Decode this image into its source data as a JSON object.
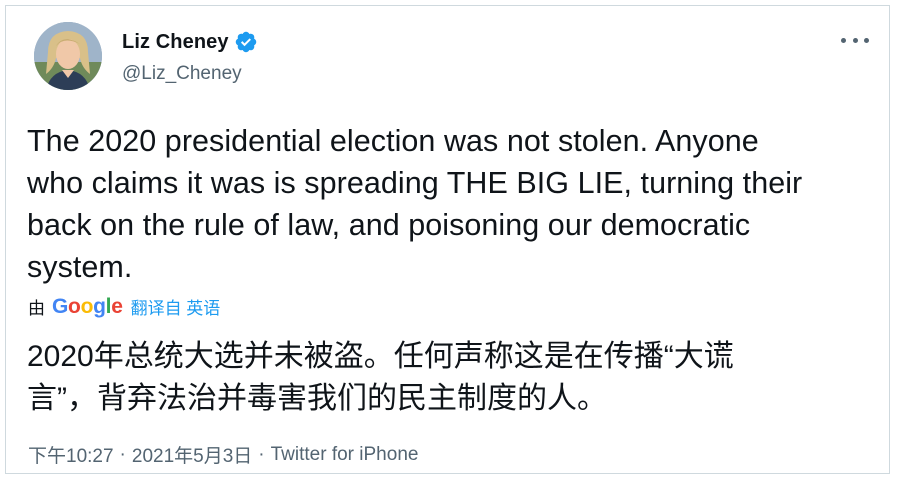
{
  "author": {
    "display_name": "Liz Cheney",
    "handle": "@Liz_Cheney",
    "verified_icon": "verified-badge-icon"
  },
  "more_icon": "more-horizontal-icon",
  "tweet": {
    "text": "The 2020 presidential election was not stolen. Anyone\nwho claims it was is spreading THE BIG LIE, turning their\nback on the rule of law, and poisoning our democratic\nsystem.",
    "translation": {
      "by_label": "由",
      "provider": "Google",
      "link_text": "翻译自 英语",
      "text": "2020年总统大选并未被盗。任何声称这是在传播“大谎\n言”，背弃法治并毒害我们的民主制度的人。"
    },
    "time": "下午10:27",
    "separator": "·",
    "date": "2021年5月3日",
    "source": "Twitter for iPhone"
  },
  "colors": {
    "text_primary": "#0f1419",
    "text_secondary": "#536471",
    "accent": "#1d9bf0",
    "border": "#cfd9de"
  }
}
